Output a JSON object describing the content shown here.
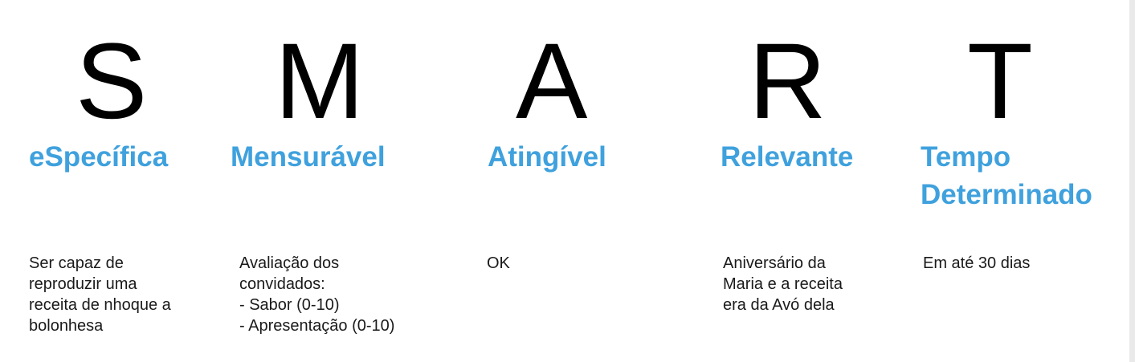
{
  "columns": [
    {
      "key": "s",
      "letter": "S",
      "term_lines": [
        "eSpecífica"
      ],
      "description_lines": [
        "Ser capaz de",
        "reproduzir uma",
        "receita de nhoque a",
        "bolonhesa"
      ]
    },
    {
      "key": "m",
      "letter": "M",
      "term_lines": [
        "Mensurável"
      ],
      "description_lines": [
        "Avaliação dos",
        "convidados:",
        "- Sabor (0-10)",
        "- Apresentação (0-10)"
      ]
    },
    {
      "key": "a",
      "letter": "A",
      "term_lines": [
        "Atingível"
      ],
      "description_lines": [
        "OK"
      ]
    },
    {
      "key": "r",
      "letter": "R",
      "term_lines": [
        "Relevante"
      ],
      "description_lines": [
        "Aniversário da",
        "Maria e a receita",
        "era da Avó dela"
      ]
    },
    {
      "key": "t",
      "letter": "T",
      "term_lines": [
        "Tempo",
        "Determinado"
      ],
      "description_lines": [
        "Em até 30 dias"
      ]
    }
  ],
  "colors": {
    "letter": "#000000",
    "term": "#3fa1dd",
    "description": "#1a1a1a",
    "background": "#ffffff"
  }
}
